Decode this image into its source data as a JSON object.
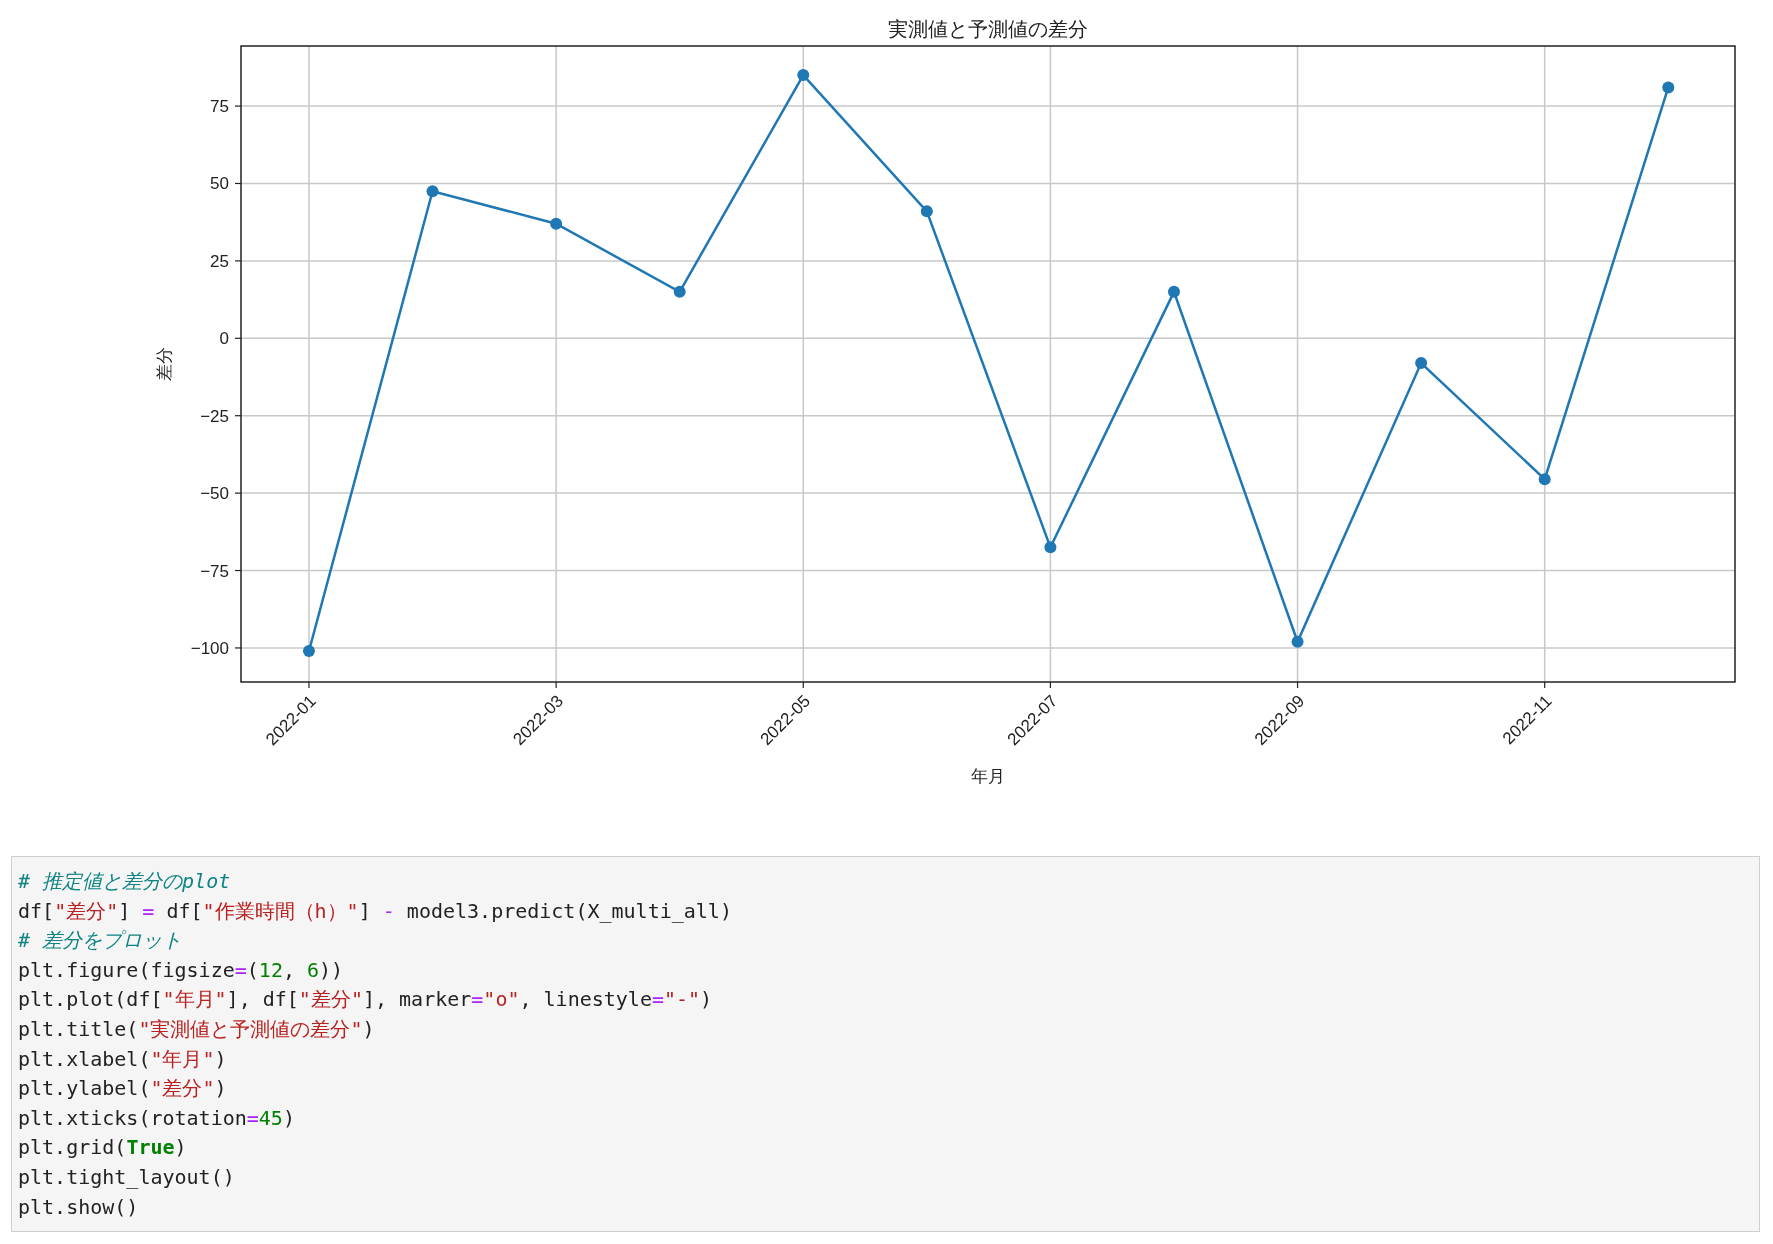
{
  "chart": {
    "chart_data": {
      "type": "line",
      "title": "実測値と予測値の差分",
      "xlabel": "年月",
      "ylabel": "差分",
      "categories": [
        "2022-01",
        null,
        "2022-03",
        null,
        "2022-05",
        null,
        "2022-07",
        null,
        "2022-09",
        null,
        "2022-11",
        null
      ],
      "series": [
        {
          "color": "#1f77b4",
          "marker": "o",
          "values": [
            -101,
            47.5,
            37,
            15,
            85,
            41,
            -67.5,
            15,
            -98,
            -8,
            -45.5,
            81
          ]
        }
      ],
      "grid": true,
      "ylim": [
        -111,
        94.4
      ],
      "yticks": [
        {
          "value": -100,
          "label": "−100"
        },
        {
          "value": -75,
          "label": "−75"
        },
        {
          "value": -50,
          "label": "−50"
        },
        {
          "value": -25,
          "label": "−25"
        },
        {
          "value": 0,
          "label": "0"
        },
        {
          "value": 25,
          "label": "25"
        },
        {
          "value": 50,
          "label": "50"
        },
        {
          "value": 75,
          "label": "75"
        }
      ]
    }
  },
  "code_cell": {
    "lines": [
      [
        {
          "kind": "comment",
          "text": "# 推定値と差分のplot"
        }
      ],
      [
        {
          "kind": "plain",
          "text": "df["
        },
        {
          "kind": "string",
          "text": "\"差分\""
        },
        {
          "kind": "plain",
          "text": "] "
        },
        {
          "kind": "operator",
          "text": "="
        },
        {
          "kind": "plain",
          "text": " df["
        },
        {
          "kind": "string",
          "text": "\"作業時間（h）\""
        },
        {
          "kind": "plain",
          "text": "] "
        },
        {
          "kind": "operator",
          "text": "-"
        },
        {
          "kind": "plain",
          "text": " model3.predict(X_multi_all)"
        }
      ],
      [
        {
          "kind": "comment",
          "text": "# 差分をプロット"
        }
      ],
      [
        {
          "kind": "plain",
          "text": "plt.figure(figsize"
        },
        {
          "kind": "operator",
          "text": "="
        },
        {
          "kind": "plain",
          "text": "("
        },
        {
          "kind": "number",
          "text": "12"
        },
        {
          "kind": "plain",
          "text": ", "
        },
        {
          "kind": "number",
          "text": "6"
        },
        {
          "kind": "plain",
          "text": "))"
        }
      ],
      [
        {
          "kind": "plain",
          "text": "plt.plot(df["
        },
        {
          "kind": "string",
          "text": "\"年月\""
        },
        {
          "kind": "plain",
          "text": "], df["
        },
        {
          "kind": "string",
          "text": "\"差分\""
        },
        {
          "kind": "plain",
          "text": "], marker"
        },
        {
          "kind": "operator",
          "text": "="
        },
        {
          "kind": "string",
          "text": "\"o\""
        },
        {
          "kind": "plain",
          "text": ", linestyle"
        },
        {
          "kind": "operator",
          "text": "="
        },
        {
          "kind": "string",
          "text": "\"-\""
        },
        {
          "kind": "plain",
          "text": ")"
        }
      ],
      [
        {
          "kind": "plain",
          "text": "plt.title("
        },
        {
          "kind": "string",
          "text": "\"実測値と予測値の差分\""
        },
        {
          "kind": "plain",
          "text": ")"
        }
      ],
      [
        {
          "kind": "plain",
          "text": "plt.xlabel("
        },
        {
          "kind": "string",
          "text": "\"年月\""
        },
        {
          "kind": "plain",
          "text": ")"
        }
      ],
      [
        {
          "kind": "plain",
          "text": "plt.ylabel("
        },
        {
          "kind": "string",
          "text": "\"差分\""
        },
        {
          "kind": "plain",
          "text": ")"
        }
      ],
      [
        {
          "kind": "plain",
          "text": "plt.xticks(rotation"
        },
        {
          "kind": "operator",
          "text": "="
        },
        {
          "kind": "number",
          "text": "45"
        },
        {
          "kind": "plain",
          "text": ")"
        }
      ],
      [
        {
          "kind": "plain",
          "text": "plt.grid("
        },
        {
          "kind": "keyword",
          "text": "True"
        },
        {
          "kind": "plain",
          "text": ")"
        }
      ],
      [
        {
          "kind": "plain",
          "text": "plt.tight_layout()"
        }
      ],
      [
        {
          "kind": "plain",
          "text": "plt.show()"
        }
      ]
    ]
  }
}
